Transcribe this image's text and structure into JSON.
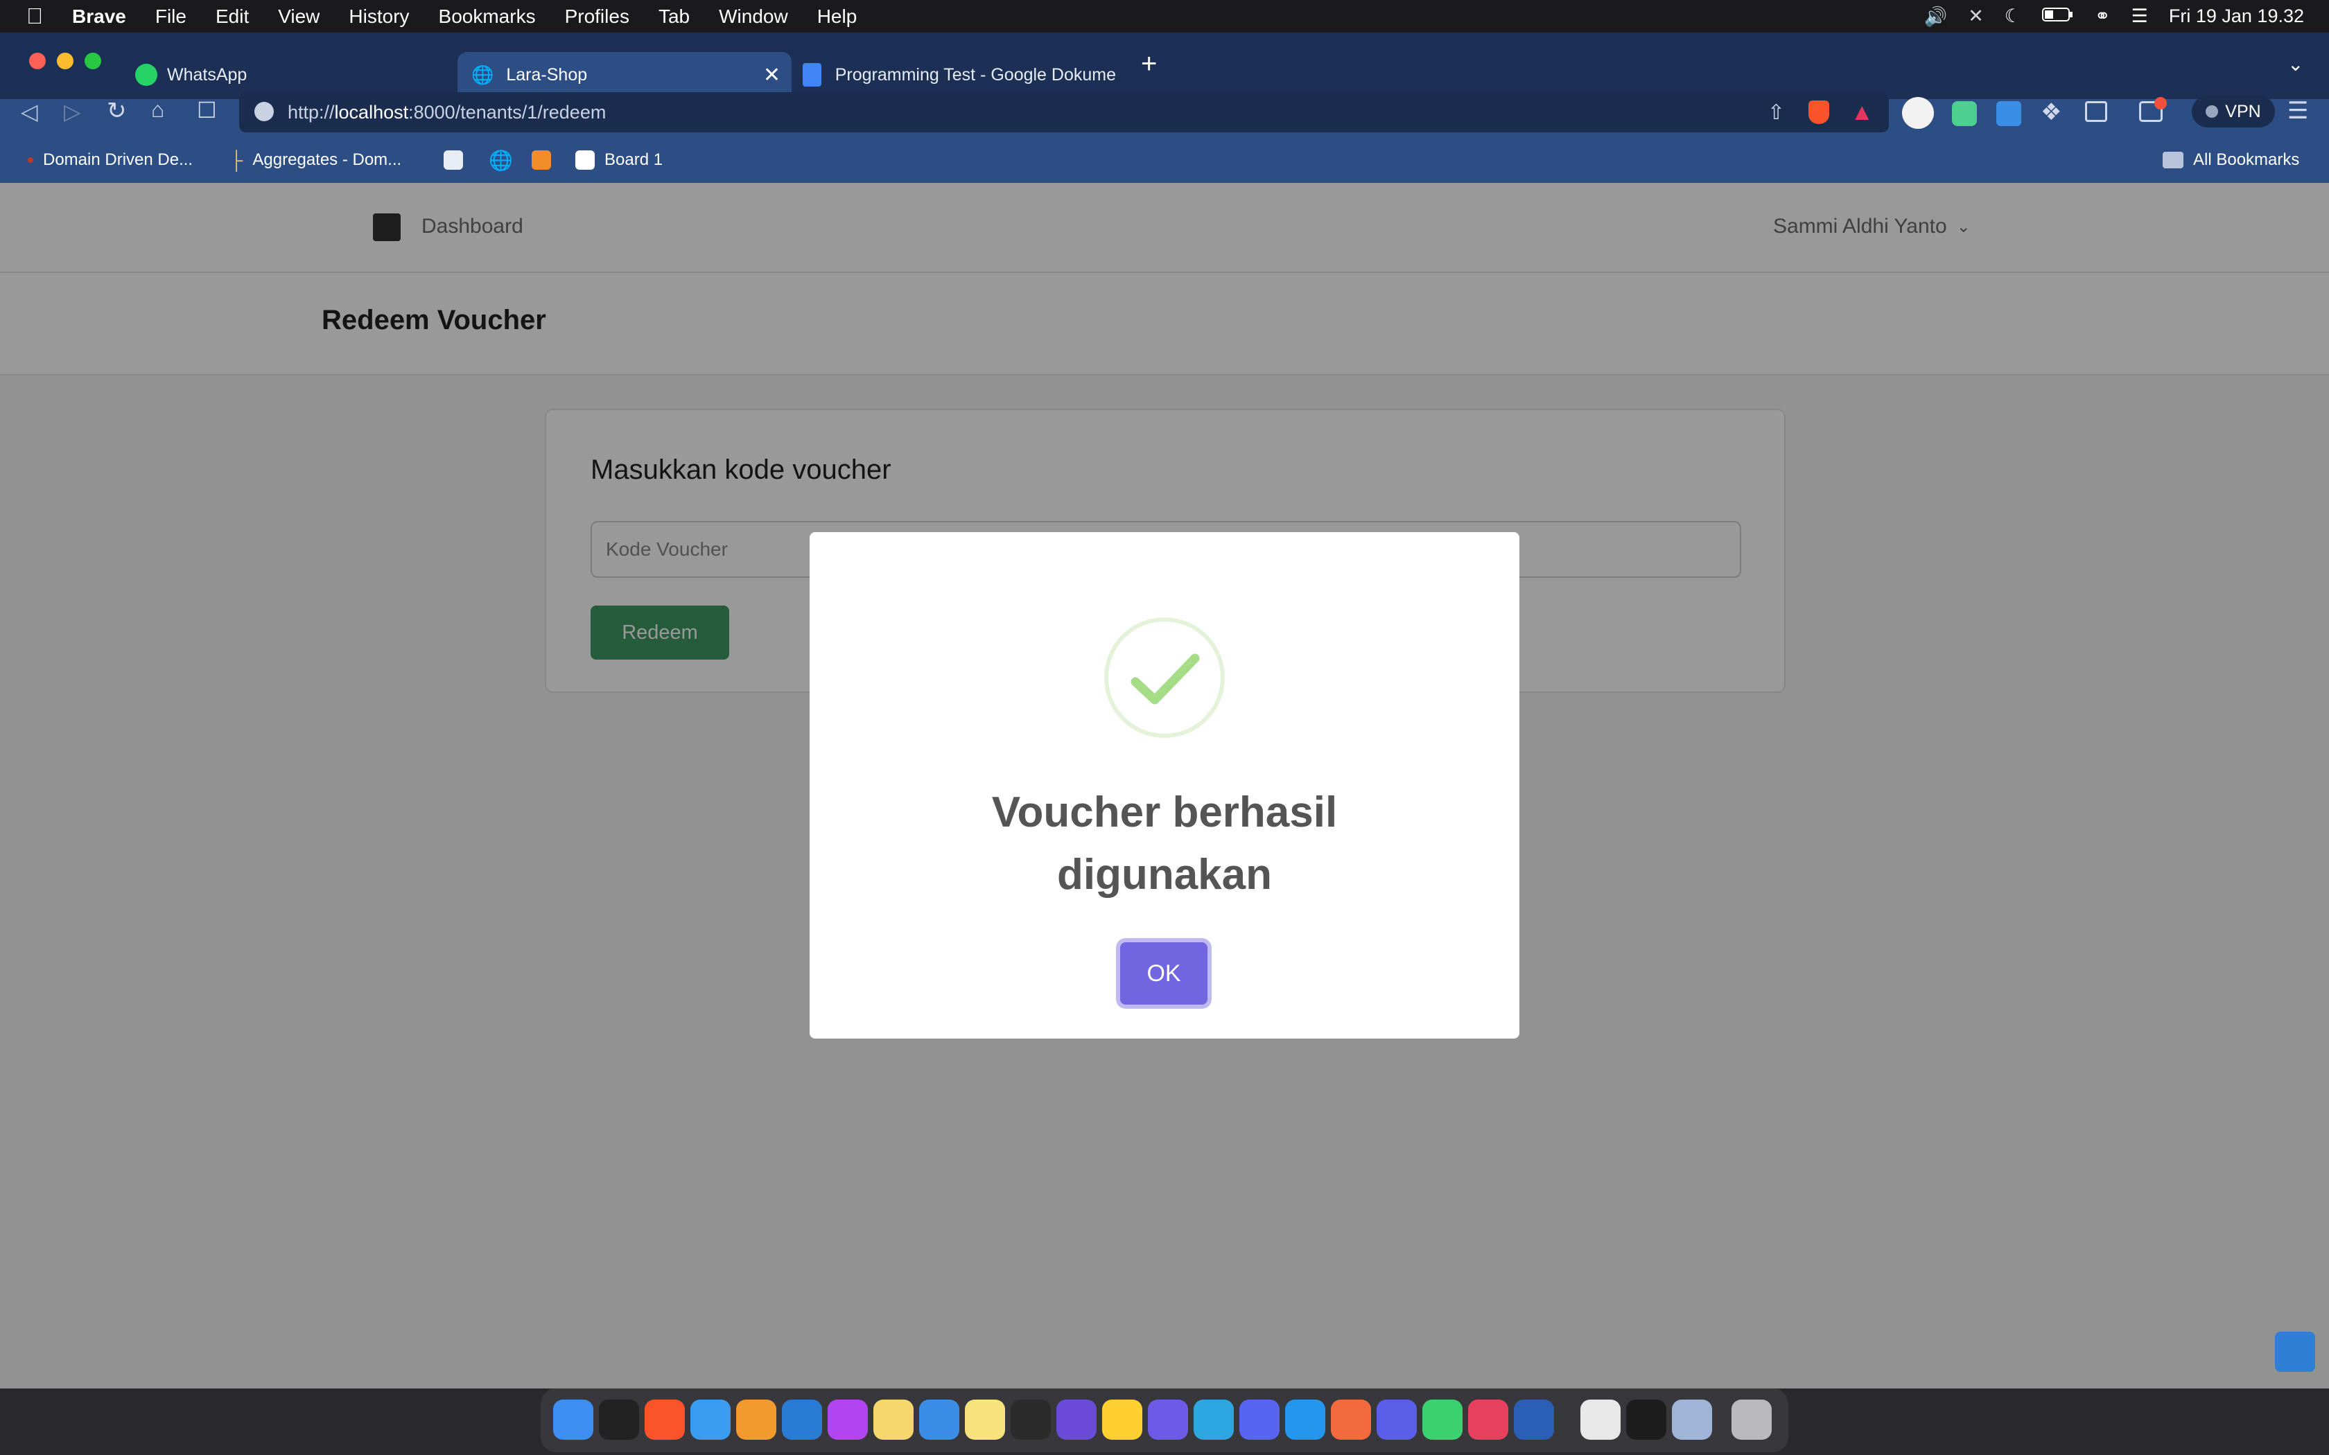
{
  "menubar": {
    "apple": "",
    "items": [
      "Brave",
      "File",
      "Edit",
      "View",
      "History",
      "Bookmarks",
      "Profiles",
      "Tab",
      "Window",
      "Help"
    ],
    "clock": "Fri 19 Jan  19.32"
  },
  "tabs": [
    {
      "label": "WhatsApp"
    },
    {
      "label": "Lara-Shop"
    },
    {
      "label": "Programming Test - Google Dokume"
    }
  ],
  "address": {
    "prefix": "http://",
    "host": "localhost",
    "rest": ":8000/tenants/1/redeem"
  },
  "vpn": "VPN",
  "bookmarks": [
    {
      "label": "Domain Driven De..."
    },
    {
      "label": "Aggregates - Dom..."
    },
    {
      "label": "Board 1"
    }
  ],
  "all_bookmarks": "All Bookmarks",
  "app": {
    "nav_dashboard": "Dashboard",
    "user_name": "Sammi Aldhi Yanto",
    "page_title": "Redeem Voucher",
    "card_title": "Masukkan kode voucher",
    "voucher_placeholder": "Kode Voucher",
    "redeem_button": "Redeem"
  },
  "modal": {
    "message_line1": "Voucher berhasil",
    "message_line2": "digunakan",
    "ok_button": "OK"
  },
  "colors": {
    "tab_bar": "#1c2f55",
    "chrome": "#2d4d85",
    "redeem_green": "#3f9a63",
    "ok_purple": "#7066e0",
    "success_check": "#a5dc86"
  }
}
